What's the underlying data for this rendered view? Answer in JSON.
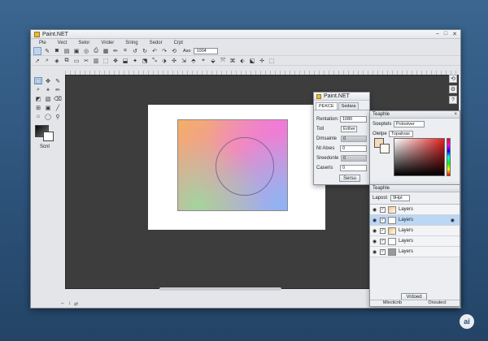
{
  "window": {
    "title": "Paint.NET",
    "controls": [
      "–",
      "□",
      "✕"
    ]
  },
  "menu": [
    "Ple",
    "Vect",
    "Selor",
    "Virder",
    "Sriing",
    "Sedor",
    "Crpt"
  ],
  "toolbar": {
    "zoom_label": "Aso",
    "zoom_value": "1004",
    "row1_icons": [
      "select-icon",
      "brush-icon",
      "image-icon",
      "document-icon",
      "save-icon",
      "adjust-icon",
      "print-icon",
      "image2-icon",
      "pencil-icon",
      "crop-icon",
      "rotate-left-icon",
      "rotate-right-icon",
      "undo-icon",
      "redo-icon",
      "refresh-icon"
    ],
    "row2_icons": [
      "arrow-icon",
      "zoom-icon",
      "layers-icon",
      "copy-icon",
      "paste-icon",
      "tool1-icon",
      "tool2-icon",
      "tool3-icon",
      "tool4-icon",
      "tool5-icon",
      "tool6-icon",
      "tool7-icon",
      "tool8-icon",
      "tool9-icon",
      "tool10-icon",
      "tool11-icon",
      "tool12-icon",
      "tool13-icon",
      "tool14-icon",
      "tool15-icon",
      "tool16-icon",
      "tool17-icon",
      "tool18-icon",
      "tool19-icon",
      "tool20-icon"
    ]
  },
  "tools": {
    "palette_label": "Scnt",
    "status_items": [
      "⇔",
      "↕",
      "⇄"
    ]
  },
  "dialog_main": {
    "title": "Paint.NET",
    "tabs": [
      "PEKCE",
      "Sedara"
    ],
    "rows": [
      {
        "label": "Rentation:",
        "value": "1080",
        "kind": "box"
      },
      {
        "label": "Toll",
        "value": "Erther",
        "kind": "box"
      },
      {
        "label": "Dmsainle",
        "value": "0",
        "kind": "bar"
      },
      {
        "label": "Nt Atxes",
        "value": "0",
        "kind": "box"
      },
      {
        "label": "Sreedonle",
        "value": "0",
        "kind": "bar"
      },
      {
        "label": "Caseris",
        "value": "0",
        "kind": "box"
      }
    ],
    "button": "Sersu"
  },
  "colors_panel": {
    "title": "Teaphle",
    "row1_label": "Soeptels",
    "row1_value": "Polostver",
    "row2_label": "Oietpe",
    "row2_value": "Topaiivas"
  },
  "layers_panel": {
    "title": "Teaphle",
    "filter_label": "Lapost",
    "filter_value": "9Hpt",
    "layers": [
      {
        "name": "Layers",
        "selected": false
      },
      {
        "name": "Layers",
        "selected": true
      },
      {
        "name": "Layers",
        "selected": false
      },
      {
        "name": "Layers",
        "selected": false
      },
      {
        "name": "Layers",
        "selected": false
      }
    ],
    "button": "Vrdoed",
    "footer_left": "Mlecticnb",
    "footer_right": "Onoutect"
  },
  "badge": "ai"
}
